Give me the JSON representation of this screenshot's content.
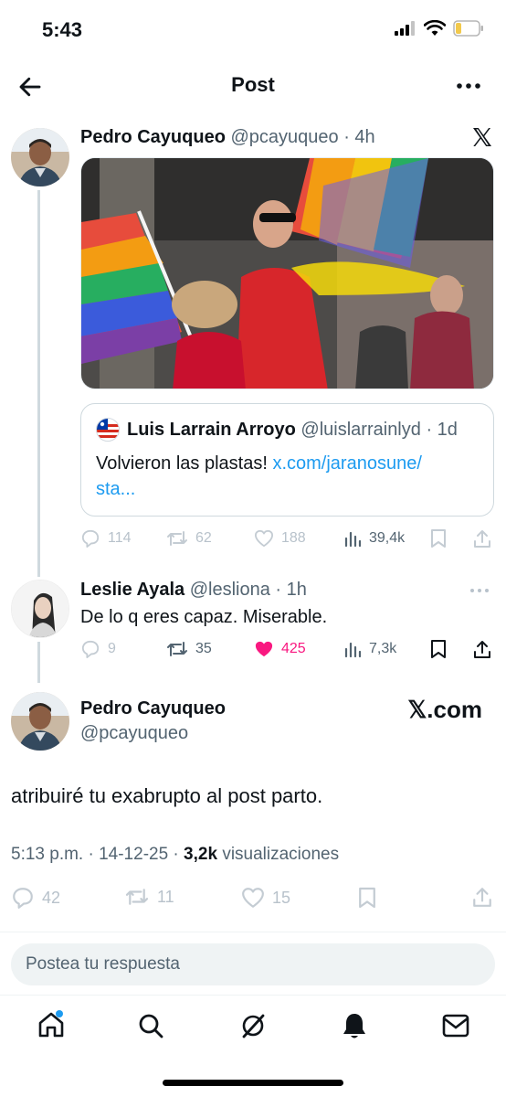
{
  "status_bar": {
    "time": "5:43"
  },
  "header": {
    "title": "Post"
  },
  "tweet1": {
    "author_name": "Pedro Cayuqueo",
    "author_handle": "@pcayuqueo",
    "time": "· 4h",
    "quote": {
      "author_name": "Luis Larrain Arroyo",
      "author_handle": "@luislarrainlyd",
      "time": "· 1d",
      "text": "Volvieron las plastas!",
      "link_text": "x.com/jaranosune/",
      "link_text2": "sta..."
    },
    "stats": {
      "replies": "114",
      "reposts": "62",
      "likes": "188",
      "views": "39,4k"
    }
  },
  "tweet2": {
    "author_name": "Leslie Ayala",
    "author_handle": "@lesliona",
    "time": "· 1h",
    "text": "De lo q eres capaz. Miserable.",
    "stats": {
      "replies": "9",
      "reposts": "35",
      "likes": "425",
      "views": "7,3k"
    }
  },
  "main_tweet": {
    "author_name": "Pedro Cayuqueo",
    "author_handle": "@pcayuqueo",
    "watermark": "𝕏.com",
    "text": "atribuiré tu exabrupto al post parto.",
    "timestamp": "5:13 p.m. · 14-12-25 ·",
    "views_count": "3,2k",
    "views_label": "visualizaciones",
    "stats": {
      "replies": "42",
      "reposts": "11",
      "likes": "15"
    }
  },
  "reply_input": {
    "placeholder": "Postea tu respuesta"
  },
  "colors": {
    "link": "#1d9bf0",
    "like_active": "#f91880",
    "text": "#0f1419",
    "muted": "#536471"
  },
  "icons": [
    "back-arrow-icon",
    "more-icon",
    "x-logo-icon",
    "reply-icon",
    "repost-icon",
    "like-icon",
    "views-icon",
    "bookmark-icon",
    "share-icon",
    "home-icon",
    "search-icon",
    "grok-icon",
    "notifications-icon",
    "messages-icon"
  ]
}
